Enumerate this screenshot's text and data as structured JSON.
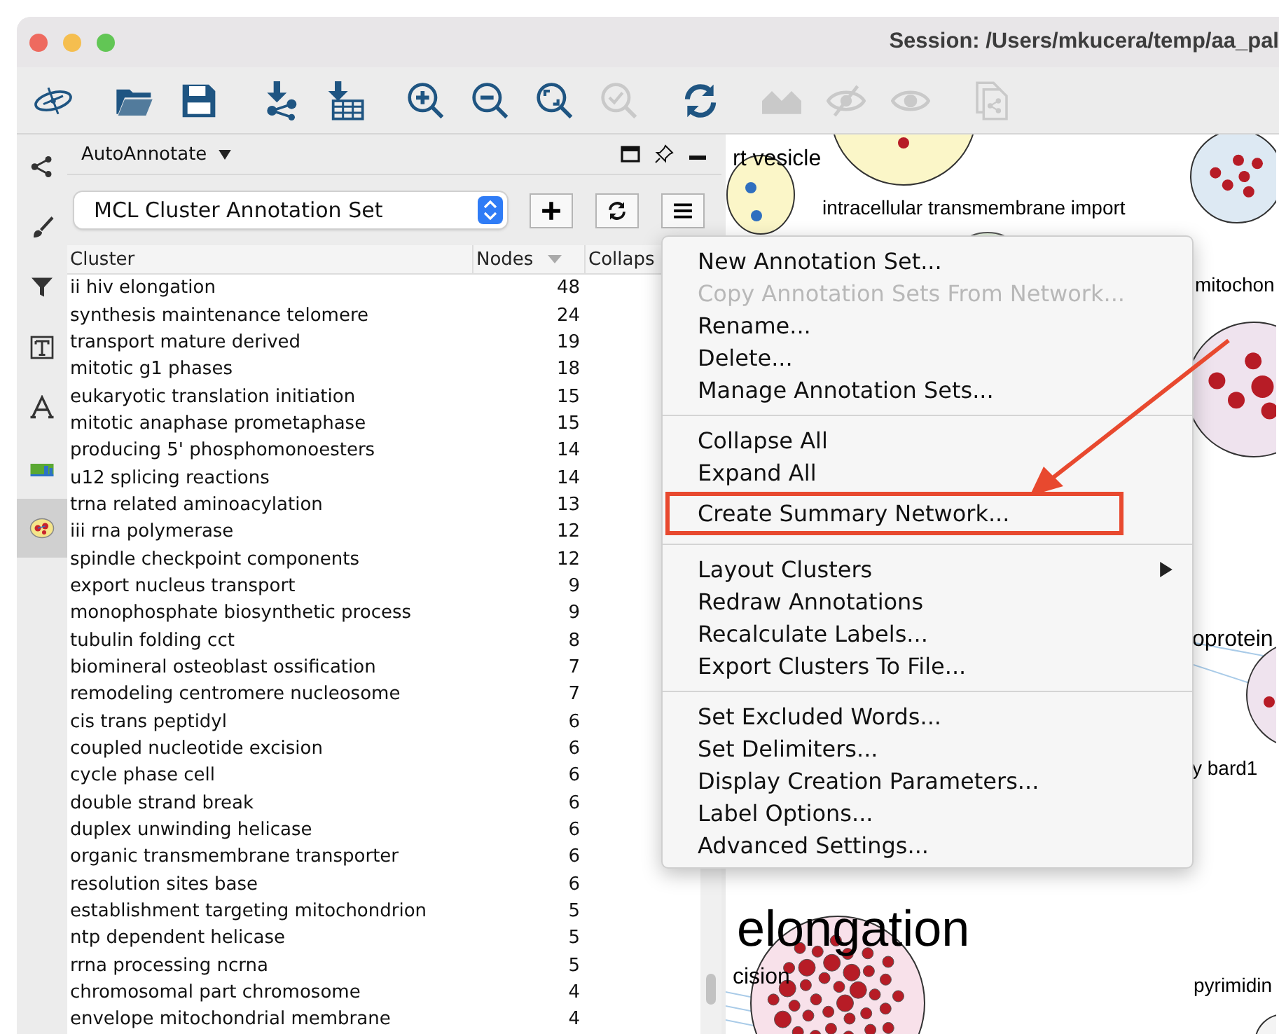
{
  "window": {
    "title": "Session: /Users/mkucera/temp/aa_pal"
  },
  "toolbar": {
    "groups": [
      {
        "items": [
          {
            "kind": "logo",
            "disabled": false
          }
        ]
      },
      {
        "items": [
          {
            "kind": "open",
            "disabled": false
          },
          {
            "kind": "save",
            "disabled": false
          }
        ]
      },
      {
        "items": [
          {
            "kind": "import-network",
            "disabled": false
          },
          {
            "kind": "import-table",
            "disabled": false
          }
        ]
      },
      {
        "items": [
          {
            "kind": "zoom-in",
            "disabled": false
          },
          {
            "kind": "zoom-out",
            "disabled": false
          },
          {
            "kind": "zoom-fit",
            "disabled": false
          },
          {
            "kind": "zoom-selected",
            "disabled": true
          }
        ]
      },
      {
        "items": [
          {
            "kind": "refresh",
            "disabled": false
          }
        ]
      },
      {
        "items": [
          {
            "kind": "home",
            "disabled": true
          },
          {
            "kind": "hide",
            "disabled": true
          },
          {
            "kind": "show",
            "disabled": true
          }
        ]
      },
      {
        "items": [
          {
            "kind": "share-doc",
            "disabled": true
          }
        ]
      }
    ]
  },
  "side_tabs": [
    {
      "kind": "network",
      "selected": false
    },
    {
      "kind": "style",
      "selected": false
    },
    {
      "kind": "filter",
      "selected": false
    },
    {
      "kind": "annotation-text",
      "selected": false
    },
    {
      "kind": "font",
      "selected": false
    },
    {
      "kind": "chart",
      "selected": false
    },
    {
      "kind": "autoannotate",
      "selected": true
    }
  ],
  "panel": {
    "title": "AutoAnnotate",
    "annotation_set": {
      "value": "MCL Cluster Annotation Set"
    },
    "table": {
      "columns": [
        {
          "label": "Cluster",
          "sorted": false
        },
        {
          "label": "Nodes",
          "sorted": true
        },
        {
          "label": "Collaps",
          "sorted": false
        }
      ],
      "rows": [
        {
          "cluster": "ii hiv elongation",
          "nodes": "48"
        },
        {
          "cluster": "synthesis maintenance telomere",
          "nodes": "24"
        },
        {
          "cluster": "transport mature derived",
          "nodes": "19"
        },
        {
          "cluster": "mitotic g1 phases",
          "nodes": "18"
        },
        {
          "cluster": "eukaryotic translation initiation",
          "nodes": "15"
        },
        {
          "cluster": "mitotic anaphase prometaphase",
          "nodes": "15"
        },
        {
          "cluster": "producing 5' phosphomonoesters",
          "nodes": "14"
        },
        {
          "cluster": "u12 splicing reactions",
          "nodes": "14"
        },
        {
          "cluster": "trna related aminoacylation",
          "nodes": "13"
        },
        {
          "cluster": "iii rna polymerase",
          "nodes": "12"
        },
        {
          "cluster": "spindle checkpoint components",
          "nodes": "12"
        },
        {
          "cluster": "export nucleus transport",
          "nodes": "9"
        },
        {
          "cluster": "monophosphate biosynthetic process",
          "nodes": "9"
        },
        {
          "cluster": "tubulin folding cct",
          "nodes": "8"
        },
        {
          "cluster": "biomineral osteoblast ossification",
          "nodes": "7"
        },
        {
          "cluster": "remodeling centromere nucleosome",
          "nodes": "7"
        },
        {
          "cluster": "cis trans peptidyl",
          "nodes": "6"
        },
        {
          "cluster": "coupled nucleotide excision",
          "nodes": "6"
        },
        {
          "cluster": "cycle phase cell",
          "nodes": "6"
        },
        {
          "cluster": "double strand break",
          "nodes": "6"
        },
        {
          "cluster": "duplex unwinding helicase",
          "nodes": "6"
        },
        {
          "cluster": "organic transmembrane transporter",
          "nodes": "6"
        },
        {
          "cluster": "resolution sites base",
          "nodes": "6"
        },
        {
          "cluster": "establishment targeting mitochondrion",
          "nodes": "5"
        },
        {
          "cluster": "ntp dependent helicase",
          "nodes": "5"
        },
        {
          "cluster": "rrna processing ncrna",
          "nodes": "5"
        },
        {
          "cluster": "chromosomal part chromosome",
          "nodes": "4"
        },
        {
          "cluster": "envelope mitochondrial membrane",
          "nodes": "4"
        }
      ]
    }
  },
  "canvas": {
    "labels": [
      "rt vesicle",
      "intracellular transmembrane import",
      "mitochon",
      "oprotein",
      "y bard1",
      "elongation",
      "cision",
      "pyrimidin"
    ]
  },
  "menu": {
    "groups": [
      {
        "items": [
          {
            "label": "New Annotation Set...",
            "disabled": false,
            "submenu": false,
            "annotated": false
          },
          {
            "label": "Copy Annotation Sets From Network...",
            "disabled": true,
            "submenu": false,
            "annotated": false
          },
          {
            "label": "Rename...",
            "disabled": false,
            "submenu": false,
            "annotated": false
          },
          {
            "label": "Delete...",
            "disabled": false,
            "submenu": false,
            "annotated": false
          },
          {
            "label": "Manage Annotation Sets...",
            "disabled": false,
            "submenu": false,
            "annotated": false
          }
        ]
      },
      {
        "items": [
          {
            "label": "Collapse All",
            "disabled": false,
            "submenu": false,
            "annotated": false
          },
          {
            "label": "Expand All",
            "disabled": false,
            "submenu": false,
            "annotated": false
          },
          {
            "label": "Create Summary Network...",
            "disabled": false,
            "submenu": false,
            "annotated": true
          }
        ]
      },
      {
        "items": [
          {
            "label": "Layout Clusters",
            "disabled": false,
            "submenu": true,
            "annotated": false
          },
          {
            "label": "Redraw Annotations",
            "disabled": false,
            "submenu": false,
            "annotated": false
          },
          {
            "label": "Recalculate Labels...",
            "disabled": false,
            "submenu": false,
            "annotated": false
          },
          {
            "label": "Export Clusters To File...",
            "disabled": false,
            "submenu": false,
            "annotated": false
          }
        ]
      },
      {
        "items": [
          {
            "label": "Set Excluded Words...",
            "disabled": false,
            "submenu": false,
            "annotated": false
          },
          {
            "label": "Set Delimiters...",
            "disabled": false,
            "submenu": false,
            "annotated": false
          },
          {
            "label": "Display Creation Parameters...",
            "disabled": false,
            "submenu": false,
            "annotated": false
          },
          {
            "label": "Label Options...",
            "disabled": false,
            "submenu": false,
            "annotated": false
          },
          {
            "label": "Advanced Settings...",
            "disabled": false,
            "submenu": false,
            "annotated": false
          }
        ]
      }
    ]
  }
}
